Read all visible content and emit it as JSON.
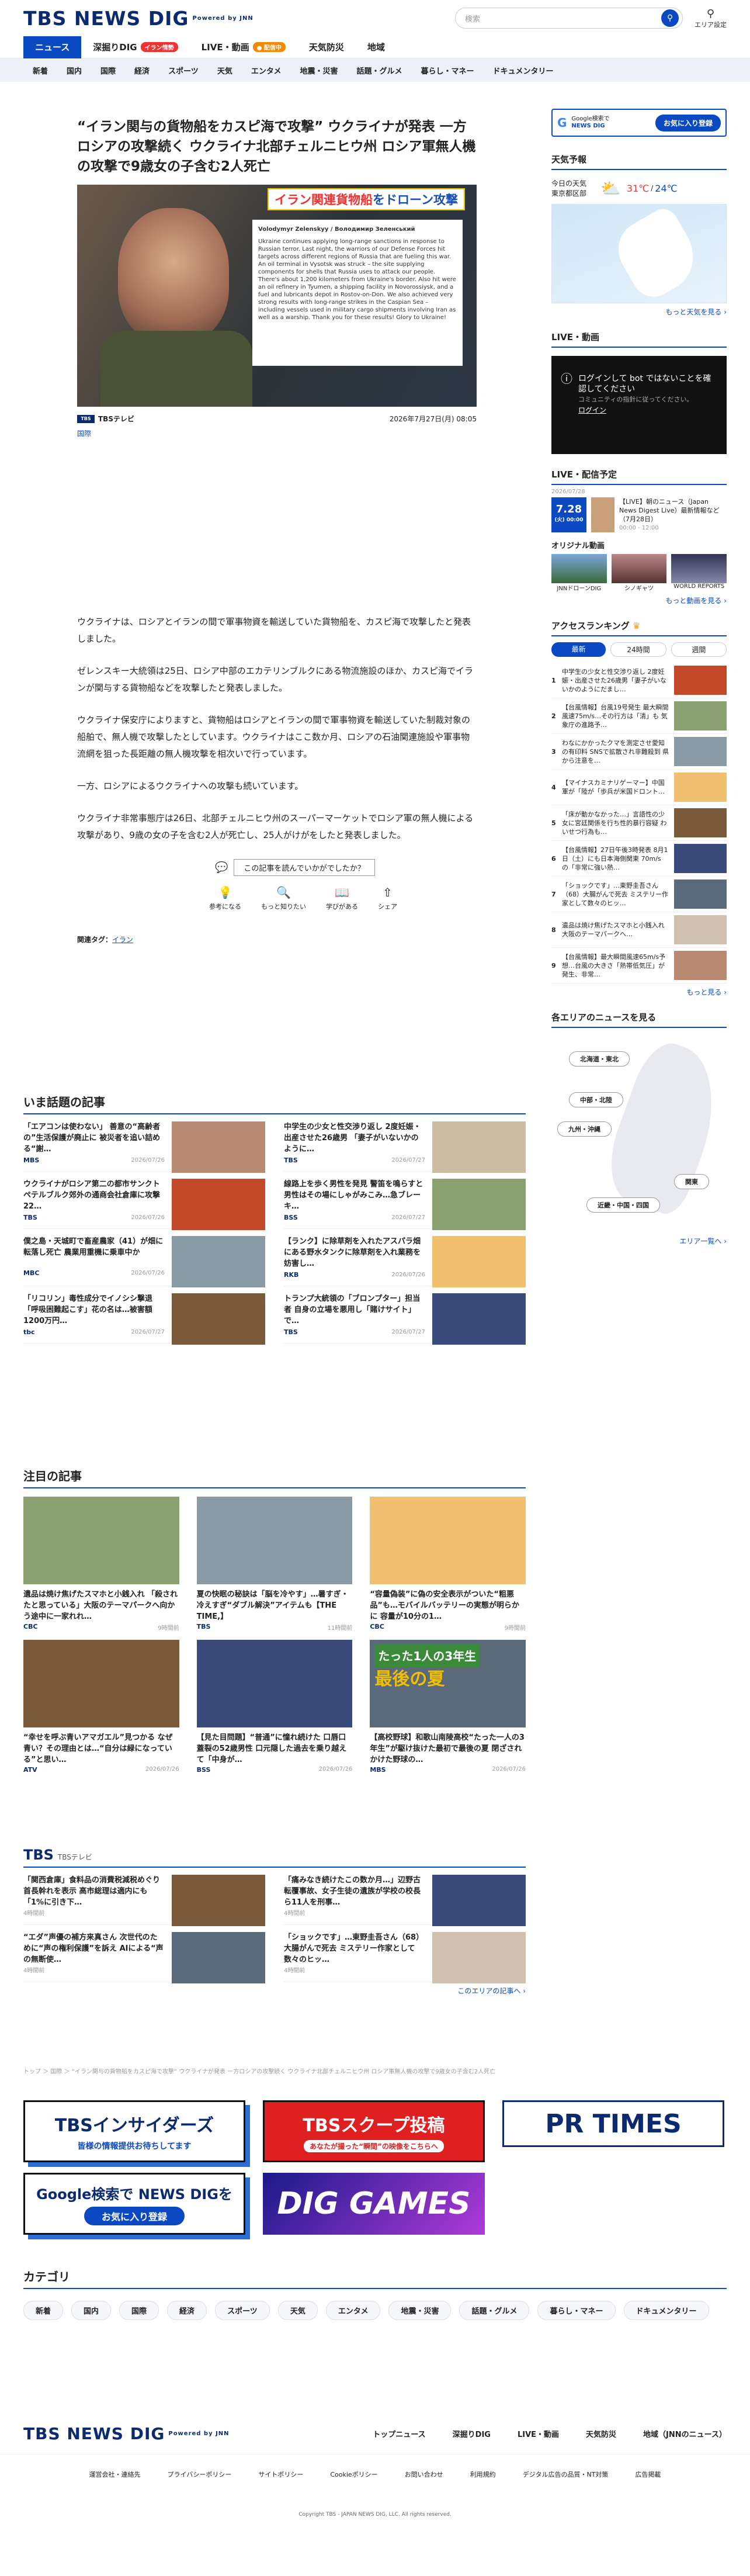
{
  "header": {
    "logo": "TBS NEWS DIG",
    "powered": "Powered by JNN",
    "search_placeholder": "検索",
    "area": "エリア設定"
  },
  "nav": {
    "items": [
      "ニュース",
      "深掘りDIG",
      "LIVE・動画",
      "天気防災",
      "地域"
    ],
    "badges": [
      "イラン情勢",
      "● 配信中"
    ]
  },
  "subnav": [
    "新着",
    "国内",
    "国際",
    "経済",
    "スポーツ",
    "天気",
    "エンタメ",
    "地震・災害",
    "話題・グルメ",
    "暮らし・マネー",
    "ドキュメンタリー"
  ],
  "article": {
    "title": "“イラン関与の貨物船をカスピ海で攻撃” ウクライナが発表 一方ロシアの攻撃続く ウクライナ北部チェルニヒウ州 ロシア軍無人機の攻撃で9歳女の子含む2人死亡",
    "caption_a": "イラン関連貨物船",
    "caption_b": "をドローン攻撃",
    "doc_head": "Volodymyr Zelenskyy / Володимир Зеленський",
    "doc_text": "Ukraine continues applying long-range sanctions in response to Russian terror. Last night, the warriors of our Defense Forces hit targets across different regions of Russia that are fueling this war. An oil terminal in Vysotsk was struck – the site supplying components for shells that Russia uses to attack our people. There's about 1,200 kilometers from Ukraine's border. Also hit were an oil refinery in Tyumen, a shipping facility in Novorossiysk, and a fuel and lubricants depot in Rostov-on-Don. We also achieved very strong results with long-range strikes in the Caspian Sea – including vessels used in military cargo shipments involving Iran as well as a warship. Thank you for these results! Glory to Ukraine!",
    "source": "TBSテレビ",
    "source_mark": "TBS",
    "date": "2026年7月27日(月) 08:05",
    "category": "国際",
    "paragraphs": [
      "ウクライナは、ロシアとイランの間で軍事物資を輸送していた貨物船を、カスピ海で攻撃したと発表しました。",
      "ゼレンスキー大統領は25日、ロシア中部のエカテリンブルクにある物流施設のほか、カスピ海でイランが関与する貨物船などを攻撃したと発表しました。",
      "ウクライナ保安庁によりますと、貨物船はロシアとイランの間で軍事物資を輸送していた制裁対象の船舶で、無人機で攻撃したとしています。ウクライナはここ数か月、ロシアの石油関連施設や軍事物流網を狙った長距離の無人機攻撃を相次いで行っています。",
      "一方、ロシアによるウクライナへの攻撃も続いています。",
      "ウクライナ非常事態庁は26日、北部チェルニヒウ州のスーパーマーケットでロシア軍の無人機による攻撃があり、9歳の女の子を含む2人が死亡し、25人がけがをしたと発表しました。"
    ],
    "feedback_q": "この記事を読んでいかがでしたか？",
    "reactions": [
      "参考になる",
      "もっと知りたい",
      "学びがある",
      "シェア"
    ],
    "tags_label": "関連タグ：",
    "tag": "イラン"
  },
  "topics": {
    "title": "いま話題の記事",
    "items": [
      {
        "t": "「エアコンは使わない」 善意の“高齢者の”生活保護が廃止に 被災者を追い詰める“謝…",
        "s": "MBS",
        "d": "2026/07/26"
      },
      {
        "t": "中学生の少女と性交渉り返し 2度妊娠・出産させた26歳男 「妻子がいないかのように…",
        "s": "TBS",
        "d": "2026/07/27"
      },
      {
        "t": "ウクライナがロシア第二の都市サンクトペテルブルク郊外の通商会社倉庫に攻撃 22…",
        "s": "TBS",
        "d": "2026/07/26"
      },
      {
        "t": "線路上を歩く男性を発見 警笛を鳴らすと男性はその場にしゃがみこみ…急ブレーキ…",
        "s": "BSS",
        "d": "2026/07/27"
      },
      {
        "t": "僕之島・天城町で畜産農家（41）が畑に転落し死亡 農業用重機に乗車中か",
        "s": "MBC",
        "d": "2026/07/26"
      },
      {
        "t": "【ランク】に除草剤を入れたアスパラ畑にある野水タンクに除草剤を入れ業務を妨害し…",
        "s": "RKB",
        "d": "2026/07/26"
      },
      {
        "t": "「リコリン」毒性成分でイノシシ撃退 「呼吸困難起こす」花の名は…被害額1200万円…",
        "s": "tbc",
        "d": "2026/07/27"
      },
      {
        "t": "トランプ大統領の「ブロンプター」担当者 自身の立場を悪用し「賭けサイト」で…",
        "s": "TBS",
        "d": "2026/07/27"
      }
    ]
  },
  "featured": {
    "title": "注目の記事",
    "items": [
      {
        "t": "遺品は焼け焦げたスマホと小銭入れ 「殺されたと思っている」大阪のテーマパークへ向かう途中に一家れれ…",
        "s": "CBC",
        "d": "9時間前"
      },
      {
        "t": "夏の快眠の秘訣は「脳を冷やす」…暑すぎ・冷えすぎ“ダブル解決”アイテムも【THE TIME,】",
        "s": "TBS",
        "d": "11時間前"
      },
      {
        "t": "“容量偽装”に偽の安全表示がついた“粗悪品”も…モバイルバッテリーの実態が明らかに 容量が10分の1…",
        "s": "CBC",
        "d": "9時間前"
      },
      {
        "t": "“幸せを呼ぶ青いアマガエル”見つかる なぜ青い？その理由とは…“自分は緑になっている”と思い…",
        "s": "ATV",
        "d": "2026/07/26"
      },
      {
        "t": "【見た目問題】“普通”に憧れ続けた 口唇口蓋裂の52歳男性 口元隠した過去を乗り越えて「中身が…",
        "s": "BSS",
        "d": "2026/07/26"
      },
      {
        "t": "【高校野球】和歌山南陵高校“たった一人の3年生”が駆け抜けた最初で最後の夏 閉ざされかけた野球の…",
        "s": "MBS",
        "d": "2026/07/26"
      }
    ]
  },
  "overlay_a": "たった1人の3年生",
  "overlay_b": "最後の夏",
  "tbs": {
    "title": "TBS",
    "sub": "TBSテレビ",
    "items": [
      {
        "t": "「関西倉庫」食料品の消費税減税めぐり首長幹れを表示 高市総理は適内にも「1%に引き下…",
        "d": "4時間前"
      },
      {
        "t": "「痛みなき続けたこの数か月…」辺野古転覆事故、女子生徒の遺族が学校の校長ら11人を刑事…",
        "d": "4時間前"
      },
      {
        "t": "“エダ”声優の補方来真さん 次世代のために“声の権利保護”を訴え AIによる“声の無断使…",
        "d": "4時間前"
      },
      {
        "t": "「ショックです」…東野圭吾さん（68）大腸がんで死去 ミステリー作家として数々のヒッ…",
        "d": "4時間前"
      }
    ],
    "more": "このエリアの記事へ ›"
  },
  "breadcrumb": "トップ ＞ 国際 ＞ “イラン関与の貨物船をカスピ海で攻撃” ウクライナが発表 一方ロシアの攻撃続く ウクライナ北部チェルニヒウ州 ロシア軍無人機の攻撃で9歳女の子含む2人死亡",
  "banners": {
    "b1": "TBSインサイダーズ",
    "b1s": "皆様の情報提供お待ちしてます",
    "b2": "TBSスクープ投稿",
    "b2s": "あなたが撮った“瞬間”の映像をこちらへ",
    "b3": "PR TIMES",
    "b4": "Google検索で NEWS DIGを",
    "b4s": "お気に入り登録",
    "b5": "DIG GAMES"
  },
  "category": {
    "title": "カテゴリ",
    "items": [
      "新着",
      "国内",
      "国際",
      "経済",
      "スポーツ",
      "天気",
      "エンタメ",
      "地震・災害",
      "話題・グルメ",
      "暮らし・マネー",
      "ドキュメンタリー"
    ]
  },
  "footer": {
    "links1": [
      "トップニュース",
      "深掘りDIG",
      "LIVE・動画",
      "天気防災",
      "地域（JNNのニュース）"
    ],
    "links2": [
      "運営会社・連絡先",
      "プライバシーポリシー",
      "サイトポリシー",
      "Cookieポリシー",
      "お問い合わせ",
      "利用規約",
      "デジタル広告の品質・NT対策",
      "広告掲載"
    ],
    "copy": "Copyright TBS - JAPAN NEWS DIG, LLC. All rights reserved."
  },
  "side": {
    "gbtn_a": "Google検索で",
    "gbtn_b": "NEWS DIG",
    "gbtn_c": "お気に入り登録",
    "weather_title": "天気予報",
    "weather_today": "今日の天気",
    "weather_loc": "東京都区部",
    "weather_hi": "31℃",
    "weather_lo": "24℃",
    "weather_more": "もっと天気を見る ›",
    "live_title": "LIVE・動画",
    "live_msg": "ログインして bot ではないことを確認してください",
    "live_sub": "コミュニティの指針に従ってください。",
    "live_login": "ログイン",
    "sched_title": "LIVE・配信予定",
    "sched_date": "2026/07/28",
    "sched_badge": "7.28",
    "sched_badge2": "(火) 00:00",
    "sched_text": "【LIVE】朝のニュース（Japan News Digest Live）最新情報など（7月28日）",
    "sched_time": "00:00 - 12:00",
    "orig_title": "オリジナル動画",
    "orig": [
      "JNNドローンDIG",
      "シノギャツ",
      "WORLD REPORTS"
    ],
    "orig_more": "もっと動画を見る ›",
    "rank_title": "アクセスランキング",
    "rank_tabs": [
      "最新",
      "24時間",
      "週間"
    ],
    "ranking": [
      "中学生の少女と性交渉り返し 2度妊娠・出産させた26歳男「妻子がいないかのようにだまし…",
      "【台風情報】台風19号発生 最大瞬間風速75m/s…その行方は「清」も 気象庁の進路予…",
      "わなにかかったクマを測定させ愛知の有印料 SNSで拡散され非難殺到 県から注意を…",
      "【マイナスカミナリゲーマー】中国軍が「陸が「歩兵が米国ドロント…",
      "「床が動かなかった…」言語性の少女に宮廷関係を行ち性的暴行容疑 わいせつ行為も…",
      "【台風情報】27日午後3時発表 8月1日（土）にも日本海側関東 70m/s の「非常に強い熱…",
      "「ショックです」…東野圭吾さん（68）大腸がんで死去 ミステリー作家として数々のヒッ…",
      "遺品は焼け焦げたスマホと小銭入れ 大阪のテーマパークへ…",
      "【台風情報】最大瞬間風速65m/s予想…台風の大きさ「熱帯低気圧」が発生、非常…"
    ],
    "rank_more": "もっと見る ›",
    "area_title": "各エリアのニュースを見る",
    "areas": [
      "北海道・東北",
      "中部・北陸",
      "九州・沖縄",
      "関東",
      "近畿・中国・四国"
    ],
    "area_more": "エリア一覧へ ›"
  }
}
